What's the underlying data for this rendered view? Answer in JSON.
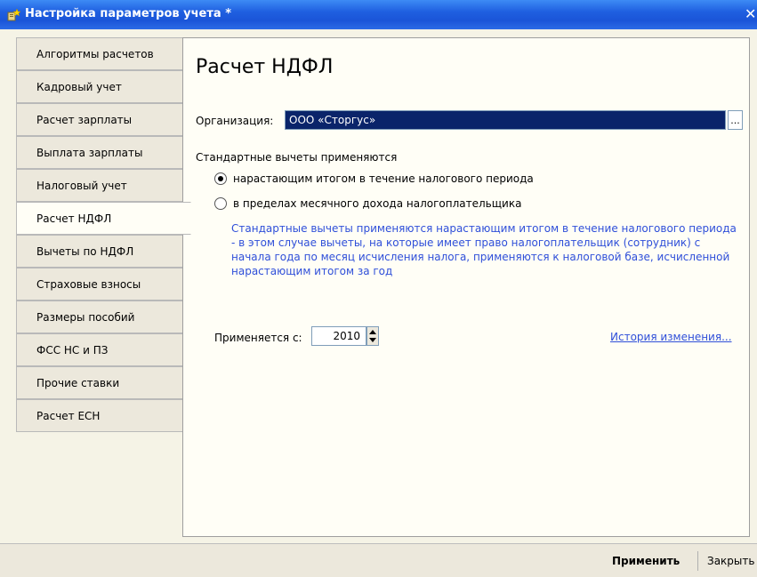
{
  "window": {
    "title": "Настройка параметров учета *",
    "close_glyph": "✕"
  },
  "sidebar": {
    "items": [
      {
        "label": "Алгоритмы расчетов"
      },
      {
        "label": "Кадровый учет"
      },
      {
        "label": "Расчет зарплаты"
      },
      {
        "label": "Выплата зарплаты"
      },
      {
        "label": "Налоговый учет"
      },
      {
        "label": "Расчет НДФЛ"
      },
      {
        "label": "Вычеты по НДФЛ"
      },
      {
        "label": "Страховые взносы"
      },
      {
        "label": "Размеры пособий"
      },
      {
        "label": "ФСС НС и ПЗ"
      },
      {
        "label": "Прочие ставки"
      },
      {
        "label": "Расчет ЕСН"
      }
    ],
    "active_index": 5
  },
  "main": {
    "title": "Расчет НДФЛ",
    "org_label": "Организация:",
    "org_value": "ООО «Сторгус»",
    "org_button": "...",
    "deductions_label": "Стандартные вычеты применяются",
    "radio_options": [
      {
        "label": "нарастающим итогом в течение налогового периода",
        "checked": true
      },
      {
        "label": "в пределах месячного дохода налогоплательщика",
        "checked": false
      }
    ],
    "note": "Стандартные вычеты применяются нарастающим итогом в течение налогового периода - в этом случае вычеты, на которые имеет право налогоплательщик (сотрудник) с начала года по месяц исчисления налога, применяются к налоговой базе, исчисленной нарастающим итогом за год",
    "applies_label": "Применяется с:",
    "applies_year": "2010",
    "history_link": "История изменения..."
  },
  "footer": {
    "apply_label": "Применить",
    "close_label": "Закрыть"
  },
  "colors": {
    "titlebar": "#1f5fe0",
    "link": "#2f4fd9",
    "selection": "#0a246a"
  }
}
